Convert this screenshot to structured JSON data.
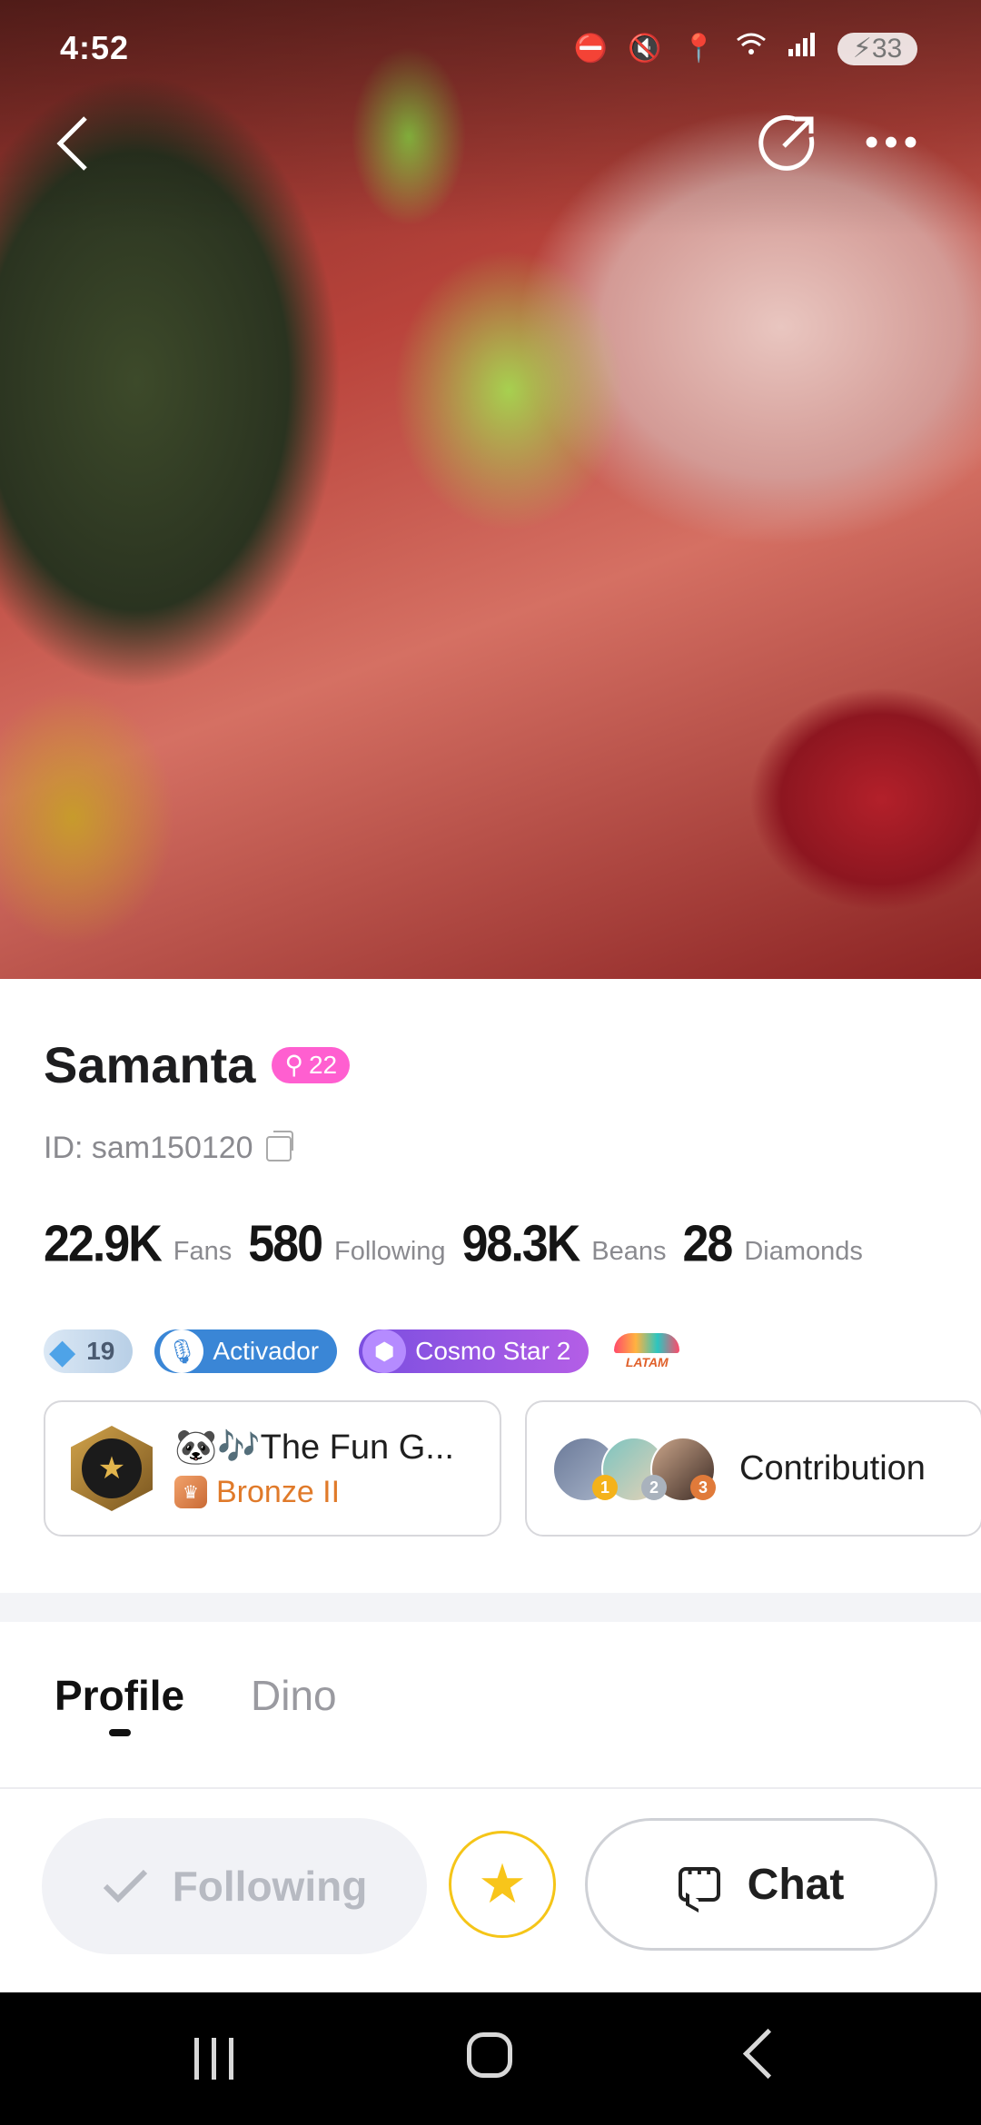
{
  "status_bar": {
    "time": "4:52",
    "battery": "33",
    "icons": [
      "do-not-disturb-icon",
      "mute-icon",
      "location-icon",
      "wifi-icon",
      "signal-icon",
      "battery-charging-icon"
    ]
  },
  "header": {
    "back_icon": "chevron-left-icon",
    "share_icon": "share-icon",
    "more_icon": "more-horizontal-icon"
  },
  "profile": {
    "name": "Samanta",
    "level": "22",
    "id_text": "ID: sam150120",
    "stats": [
      {
        "value": "22.9K",
        "label": "Fans"
      },
      {
        "value": "580",
        "label": "Following"
      },
      {
        "value": "98.3K",
        "label": "Beans"
      },
      {
        "value": "28",
        "label": "Diamonds"
      }
    ],
    "badges": {
      "diamond_level": "19",
      "activador": "Activador",
      "cosmo": "Cosmo Star 2",
      "latam": "LATAM"
    }
  },
  "family": {
    "name": "🐼🎶The Fun G...",
    "rank": "Bronze II"
  },
  "contribution": {
    "label": "Contribution",
    "ranks": [
      "1",
      "2",
      "3"
    ]
  },
  "tabs": [
    {
      "label": "Profile",
      "active": true
    },
    {
      "label": "Dino",
      "active": false
    }
  ],
  "actions": {
    "following_label": "Following",
    "chat_label": "Chat"
  },
  "colors": {
    "level_badge": "#ff5fd0",
    "family_rank": "#e07a2a",
    "star": "#f8c51a"
  }
}
